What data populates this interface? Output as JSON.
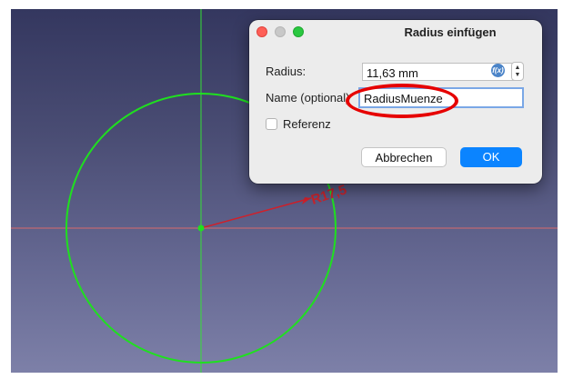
{
  "viewport": {
    "dimension_label": "R17,5",
    "colors": {
      "circle": "#1fe01f",
      "axis_vertical": "#35e035",
      "axis_horizontal": "#d86a6a",
      "radius_line": "#d0202a"
    }
  },
  "dialog": {
    "title": "Radius einfügen",
    "radius_label": "Radius:",
    "radius_value": "11,63 mm",
    "expression_icon": "f(x)",
    "name_label": "Name (optional)",
    "name_value": "RadiusMuenze",
    "reference_label": "Referenz",
    "reference_checked": false,
    "cancel_label": "Abbrechen",
    "ok_label": "OK"
  },
  "annotation": {
    "highlight_color": "#e60000"
  }
}
